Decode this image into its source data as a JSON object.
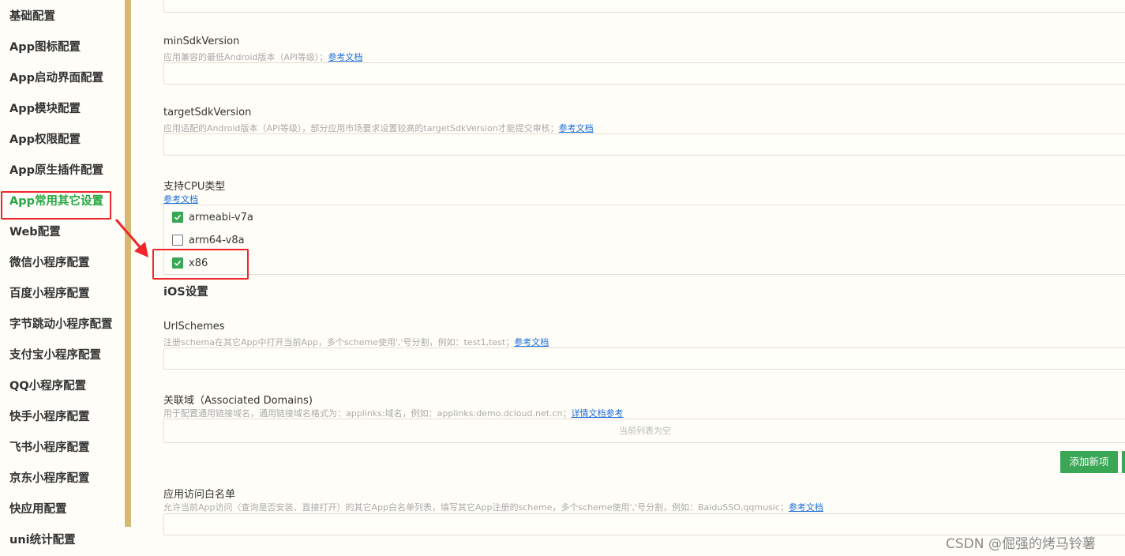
{
  "sidebar": {
    "items": [
      {
        "label": "基础配置"
      },
      {
        "label": "App图标配置"
      },
      {
        "label": "App启动界面配置"
      },
      {
        "label": "App模块配置"
      },
      {
        "label": "App权限配置"
      },
      {
        "label": "App原生插件配置"
      },
      {
        "label": "App常用其它设置",
        "active": true
      },
      {
        "label": "Web配置"
      },
      {
        "label": "微信小程序配置"
      },
      {
        "label": "百度小程序配置"
      },
      {
        "label": "字节跳动小程序配置"
      },
      {
        "label": "支付宝小程序配置"
      },
      {
        "label": "QQ小程序配置"
      },
      {
        "label": "快手小程序配置"
      },
      {
        "label": "飞书小程序配置"
      },
      {
        "label": "京东小程序配置"
      },
      {
        "label": "快应用配置"
      },
      {
        "label": "uni统计配置"
      }
    ]
  },
  "fields": {
    "minSdk": {
      "label": "minSdkVersion",
      "desc": "应用兼容的最低Android版本（API等级）；",
      "link": "参考文档",
      "value": ""
    },
    "targetSdk": {
      "label": "targetSdkVersion",
      "desc": "应用适配的Android版本（API等级），部分应用市场要求设置较高的targetSdkVersion才能提交审核；",
      "link": "参考文档",
      "value": ""
    },
    "cpu": {
      "label": "支持CPU类型",
      "link": "参考文档",
      "options": [
        {
          "label": "armeabi-v7a",
          "checked": true
        },
        {
          "label": "arm64-v8a",
          "checked": false
        },
        {
          "label": "x86",
          "checked": true
        }
      ]
    },
    "ios_title": "iOS设置",
    "urlSchemes": {
      "label": "UrlSchemes",
      "desc": "注册schema在其它App中打开当前App，多个scheme使用','号分割，例如：test1,test；",
      "link": "参考文档",
      "value": ""
    },
    "domains": {
      "label": "关联域（Associated Domains)",
      "desc": "用于配置通用链接域名，通用链接域名格式为：applinks:域名，例如：applinks:demo.dcloud.net.cn；",
      "link": "详情文档参考",
      "empty_text": "当前列表为空",
      "add_button": "添加新项"
    },
    "whitelist": {
      "label": "应用访问白名单",
      "desc": "允许当前App访问（查询是否安装、直接打开）的其它App白名单列表，填写其它App注册的scheme，多个scheme使用','号分割，例如：BaiduSSO,qqmusic；",
      "link": "参考文档",
      "value": ""
    }
  },
  "watermark": "CSDN @倔强的烤马铃薯",
  "colors": {
    "accent_green": "#3aa757",
    "active_text": "#28a745",
    "sidebar_bar": "#d6ba71",
    "highlight_red": "#f0272a",
    "link_blue": "#1e6fd9"
  }
}
